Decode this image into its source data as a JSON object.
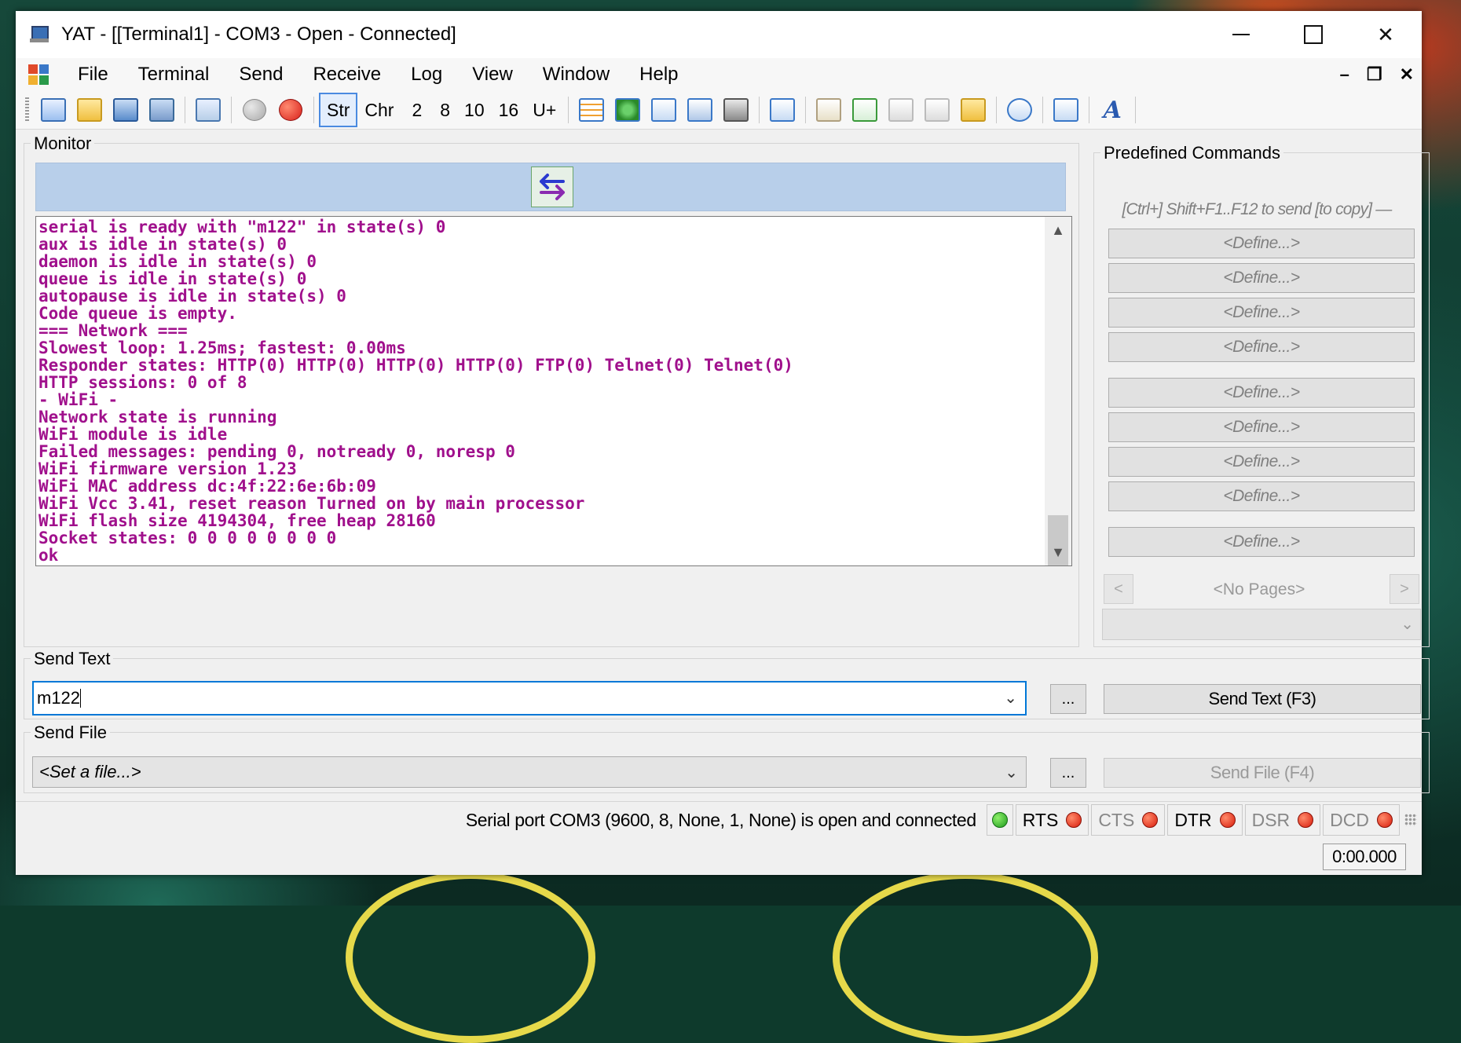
{
  "window": {
    "title": "YAT - [[Terminal1] - COM3 - Open - Connected]"
  },
  "menu": [
    "File",
    "Terminal",
    "Send",
    "Receive",
    "Log",
    "View",
    "Window",
    "Help"
  ],
  "toolbar": {
    "radix_buttons": [
      "Str",
      "Chr",
      "2",
      "8",
      "10",
      "16",
      "U+"
    ],
    "active_radix": "Str"
  },
  "monitor": {
    "label": "Monitor",
    "lines": [
      "serial is ready with \"m122\" in state(s) 0",
      "aux is idle in state(s) 0",
      "daemon is idle in state(s) 0",
      "queue is idle in state(s) 0",
      "autopause is idle in state(s) 0",
      "Code queue is empty.",
      "=== Network ===",
      "Slowest loop: 1.25ms; fastest: 0.00ms",
      "Responder states: HTTP(0) HTTP(0) HTTP(0) HTTP(0) FTP(0) Telnet(0) Telnet(0)",
      "HTTP sessions: 0 of 8",
      "- WiFi -",
      "Network state is running",
      "WiFi module is idle",
      "Failed messages: pending 0, notready 0, noresp 0",
      "WiFi firmware version 1.23",
      "WiFi MAC address dc:4f:22:6e:6b:09",
      "WiFi Vcc 3.41, reset reason Turned on by main processor",
      "WiFi flash size 4194304, free heap 28160",
      "Socket states: 0 0 0 0 0 0 0 0",
      "ok"
    ],
    "text_color": "#a0108c"
  },
  "predefined": {
    "label": "Predefined Commands",
    "hint": "[Ctrl+] Shift+F1..F12 to send [to copy] —",
    "buttons": [
      "<Define...>",
      "<Define...>",
      "<Define...>",
      "<Define...>",
      "<Define...>",
      "<Define...>",
      "<Define...>",
      "<Define...>",
      "<Define...>"
    ],
    "pages_label": "<No Pages>",
    "prev": "<",
    "next": ">"
  },
  "send_text": {
    "label": "Send Text",
    "value": "m122",
    "dots": "...",
    "button": "Send Text (F3)"
  },
  "send_file": {
    "label": "Send File",
    "value": "<Set a file...>",
    "dots": "...",
    "button": "Send File (F4)"
  },
  "status": {
    "message": "Serial port COM3 (9600, 8, None, 1, None) is open and connected",
    "signals": [
      {
        "name": "RTS",
        "state": "red",
        "dim": false
      },
      {
        "name": "CTS",
        "state": "red",
        "dim": true
      },
      {
        "name": "DTR",
        "state": "red",
        "dim": false
      },
      {
        "name": "DSR",
        "state": "red",
        "dim": true
      },
      {
        "name": "DCD",
        "state": "red",
        "dim": true
      }
    ],
    "timer": "0:00.000"
  },
  "icons": {
    "app": "yat-app-icon",
    "direction": "bidirectional-arrows-icon"
  }
}
